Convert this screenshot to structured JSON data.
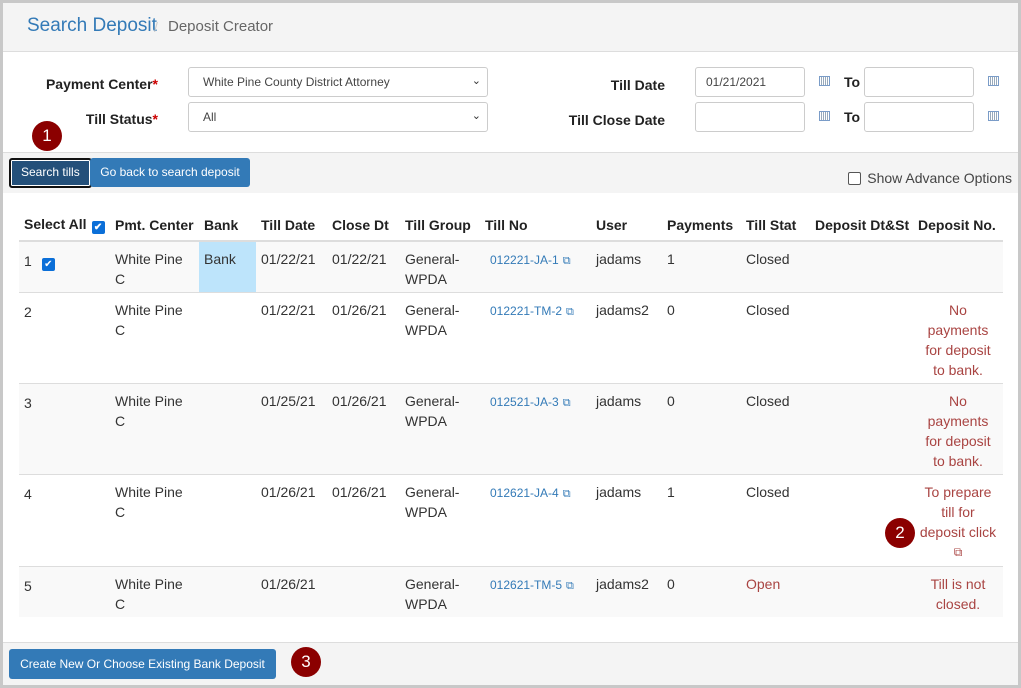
{
  "breadcrumb": {
    "root": "Search Deposit",
    "separator": "/",
    "current": "Deposit Creator"
  },
  "form": {
    "payment_center": {
      "label": "Payment Center",
      "required": "*",
      "value": "White Pine County District Attorney"
    },
    "till_status": {
      "label": "Till Status",
      "required": "*",
      "value": "All"
    },
    "till_date": {
      "label": "Till Date",
      "from": "01/21/2021",
      "to_label": "To",
      "to": ""
    },
    "till_close_date": {
      "label": "Till Close Date",
      "from": "",
      "to_label": "To",
      "to": ""
    }
  },
  "toolbar": {
    "search_tills": "Search tills",
    "go_back": "Go back to search deposit",
    "show_advance": "Show Advance Options",
    "show_advance_checked": false
  },
  "badges": [
    "1",
    "2",
    "3"
  ],
  "table": {
    "headers": [
      "Select All",
      "Pmt. Center",
      "Bank",
      "Till Date",
      "Close Dt",
      "Till Group",
      "Till No",
      "User",
      "Payments",
      "Till Stat",
      "Deposit Dt&St",
      "Deposit No."
    ],
    "select_all_checked": true,
    "rows": [
      {
        "num": "1",
        "checked": true,
        "center": "White Pine C",
        "bank": "Bank",
        "till_date": "01/22/21",
        "close_dt": "01/22/21",
        "group": "General-WPDA",
        "till_no": "012221-JA-1",
        "user": "jadams",
        "payments": "1",
        "status": "Closed",
        "dep_dt": "",
        "dep_no": ""
      },
      {
        "num": "2",
        "checked": false,
        "center": "White Pine C",
        "bank": "",
        "till_date": "01/22/21",
        "close_dt": "01/26/21",
        "group": "General-WPDA",
        "till_no": "012221-TM-2",
        "user": "jadams2",
        "payments": "0",
        "status": "Closed",
        "dep_dt": "",
        "dep_no": "No payments for deposit to bank."
      },
      {
        "num": "3",
        "checked": false,
        "center": "White Pine C",
        "bank": "",
        "till_date": "01/25/21",
        "close_dt": "01/26/21",
        "group": "General-WPDA",
        "till_no": "012521-JA-3",
        "user": "jadams",
        "payments": "0",
        "status": "Closed",
        "dep_dt": "",
        "dep_no": "No payments for deposit to bank."
      },
      {
        "num": "4",
        "checked": false,
        "center": "White Pine C",
        "bank": "",
        "till_date": "01/26/21",
        "close_dt": "01/26/21",
        "group": "General-WPDA",
        "till_no": "012621-JA-4",
        "user": "jadams",
        "payments": "1",
        "status": "Closed",
        "dep_dt": "",
        "dep_no": "To prepare till for deposit click"
      },
      {
        "num": "5",
        "checked": false,
        "center": "White Pine C",
        "bank": "",
        "till_date": "01/26/21",
        "close_dt": "",
        "group": "General-WPDA",
        "till_no": "012621-TM-5",
        "user": "jadams2",
        "payments": "0",
        "status": "Open",
        "dep_dt": "",
        "dep_no": "Till is not closed."
      }
    ]
  },
  "footer": {
    "create_button": "Create New Or Choose Existing Bank Deposit"
  },
  "colors": {
    "primary": "#337ab7",
    "warning_text": "#a94442",
    "badge": "#8b0000",
    "bank_highlight": "#bde4fb"
  }
}
